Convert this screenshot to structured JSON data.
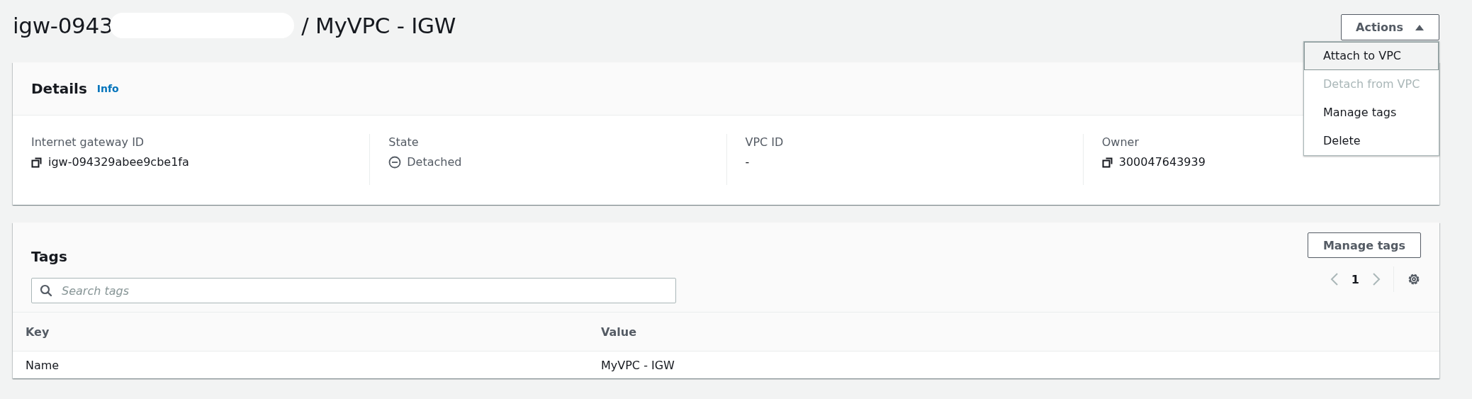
{
  "header": {
    "title_start": "igw-0943",
    "redacted": true,
    "title_end": "/ MyVPC - IGW",
    "actions_button": {
      "label": "Actions",
      "expanded": true
    }
  },
  "actions_menu": [
    {
      "label": "Attach to VPC",
      "highlighted": true,
      "disabled": false
    },
    {
      "label": "Detach from VPC",
      "highlighted": false,
      "disabled": true
    },
    {
      "label": "Manage tags",
      "highlighted": false,
      "disabled": false
    },
    {
      "label": "Delete",
      "highlighted": false,
      "disabled": false
    }
  ],
  "details": {
    "title": "Details",
    "info_link": "Info",
    "fields": [
      {
        "label": "Internet gateway ID",
        "value": "igw-094329abee9cbe1fa",
        "kind": "copyable"
      },
      {
        "label": "State",
        "value": "Detached",
        "kind": "status"
      },
      {
        "label": "VPC ID",
        "value": "-",
        "kind": "plain"
      },
      {
        "label": "Owner",
        "value": "300047643939",
        "kind": "copyable"
      }
    ]
  },
  "tags": {
    "title": "Tags",
    "manage_button": "Manage tags",
    "search": {
      "placeholder": "Search tags"
    },
    "page": "1",
    "columns": [
      "Key",
      "Value"
    ],
    "rows": [
      [
        "Name",
        "MyVPC - IGW"
      ]
    ]
  }
}
